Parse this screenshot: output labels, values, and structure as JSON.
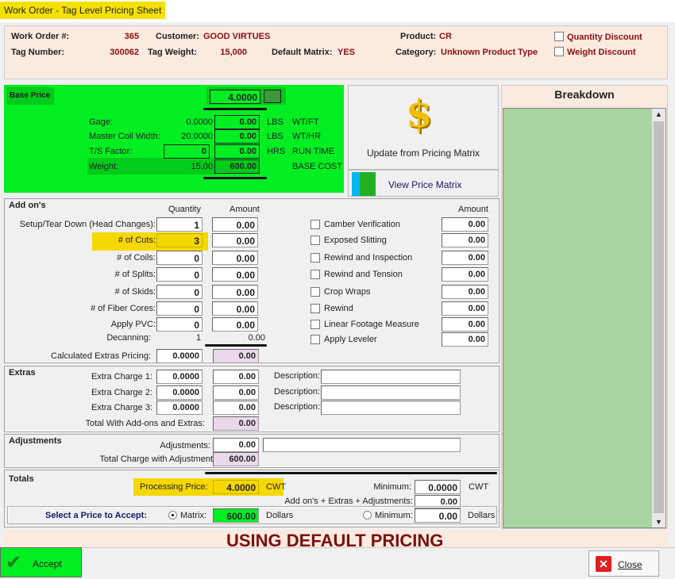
{
  "window": {
    "title": "Work Order - Tag Level Pricing Sheet"
  },
  "header": {
    "work_order_label": "Work Order #:",
    "work_order": "365",
    "customer_label": "Customer:",
    "customer": "GOOD VIRTUES",
    "product_label": "Product:",
    "product": "CR",
    "tag_number_label": "Tag Number:",
    "tag_number": "300062",
    "tag_weight_label": "Tag Weight:",
    "tag_weight": "15,000",
    "default_matrix_label": "Default Matrix:",
    "default_matrix": "YES",
    "category_label": "Category:",
    "category": "Unknown Product Type",
    "quantity_discount": "Quantity Discount",
    "weight_discount": "Weight Discount"
  },
  "base": {
    "title": "Base Price",
    "price": "4.0000",
    "gage_label": "Gage:",
    "gage": "0.0000",
    "gage_amt": "0.00",
    "gage_unit": "LBS",
    "gage_desc": "WT/FT",
    "mcw_label": "Master Coil Width:",
    "mcw": "20.0000",
    "mcw_amt": "0.00",
    "mcw_unit": "LBS",
    "mcw_desc": "WT/HR",
    "ts_label": "T/S Factor:",
    "ts": "0",
    "ts_amt": "0.00",
    "ts_unit": "HRS",
    "ts_desc": "RUN TIME",
    "weight_label": "Weight:",
    "weight": "15,00",
    "weight_amt": "600.00",
    "weight_desc": "BASE COST"
  },
  "actions": {
    "update": "Update from Pricing Matrix",
    "view_matrix": "View Price Matrix"
  },
  "breakdown": {
    "title": "Breakdown"
  },
  "addons": {
    "title": "Add on's",
    "qty_header": "Quantity",
    "amount_header": "Amount",
    "right_amount_header": "Amount",
    "rows": [
      {
        "label": "Setup/Tear Down (Head Changes):",
        "qty": "1",
        "amount": "0.00"
      },
      {
        "label": "# of Cuts:",
        "qty": "3",
        "amount": "0.00"
      },
      {
        "label": "# of Coils:",
        "qty": "0",
        "amount": "0.00"
      },
      {
        "label": "# of Splits:",
        "qty": "0",
        "amount": "0.00"
      },
      {
        "label": "# of Skids:",
        "qty": "0",
        "amount": "0.00"
      },
      {
        "label": "# of Fiber Cores:",
        "qty": "0",
        "amount": "0.00"
      },
      {
        "label": "Apply PVC:",
        "qty": "0",
        "amount": "0.00"
      }
    ],
    "decanning_label": "Decanning:",
    "decanning_qty": "1",
    "decanning_amount": "0.00",
    "calc_label": "Calculated Extras Pricing:",
    "calc_qty": "0.0000",
    "calc_amount": "0.00",
    "options": [
      {
        "label": "Camber Verification",
        "checked": false,
        "amount": "0.00"
      },
      {
        "label": "Exposed Slitting",
        "checked": false,
        "amount": "0.00"
      },
      {
        "label": "Rewind and Inspection",
        "checked": false,
        "amount": "0.00"
      },
      {
        "label": "Rewind and Tension",
        "checked": false,
        "amount": "0.00"
      },
      {
        "label": "Crop Wraps",
        "checked": false,
        "amount": "0.00"
      },
      {
        "label": "Rewind",
        "checked": false,
        "amount": "0.00"
      },
      {
        "label": "Linear Footage Measure",
        "checked": false,
        "amount": "0.00"
      },
      {
        "label": "Apply Leveler",
        "checked": false,
        "amount": "0.00"
      }
    ]
  },
  "extras": {
    "title": "Extras",
    "rows": [
      {
        "label": "Extra Charge 1:",
        "rate": "0.0000",
        "amount": "0.00",
        "desc_label": "Description:",
        "desc": ""
      },
      {
        "label": "Extra Charge 2:",
        "rate": "0.0000",
        "amount": "0.00",
        "desc_label": "Description:",
        "desc": ""
      },
      {
        "label": "Extra Charge 3:",
        "rate": "0.0000",
        "amount": "0.00",
        "desc_label": "Description:",
        "desc": ""
      }
    ],
    "total_label": "Total With Add-ons and Extras:",
    "total": "0.00"
  },
  "adjustments": {
    "title": "Adjustments",
    "label": "Adjustments:",
    "value": "0.00",
    "note": "",
    "total_label": "Total Charge with Adjustment",
    "total": "600.00"
  },
  "totals": {
    "title": "Totals",
    "processing_label": "Processing Price:",
    "processing": "4.0000",
    "cwt": "CWT",
    "minimum_label": "Minimum:",
    "minimum": "0.0000",
    "minimum_unit": "CWT",
    "extras_label": "Add on's + Extras + Adjustments:",
    "extras": "0.00",
    "select_label": "Select a Price to Accept:",
    "matrix_label": "Matrix:",
    "matrix": "600.00",
    "dollars": "Dollars",
    "min_radio_label": "Minimum:",
    "min_dollars": "0.00",
    "min_unit": "Dollars",
    "selected": "Matrix"
  },
  "banner": "USING DEFAULT PRICING",
  "footer": {
    "accept": "Accept",
    "close": "Close"
  },
  "colors": {
    "green": "#00ee22",
    "yellow": "#f5e100",
    "peach": "#fbeae0",
    "value_red": "#8b1010",
    "breakdown_green": "#a8d5a2"
  }
}
